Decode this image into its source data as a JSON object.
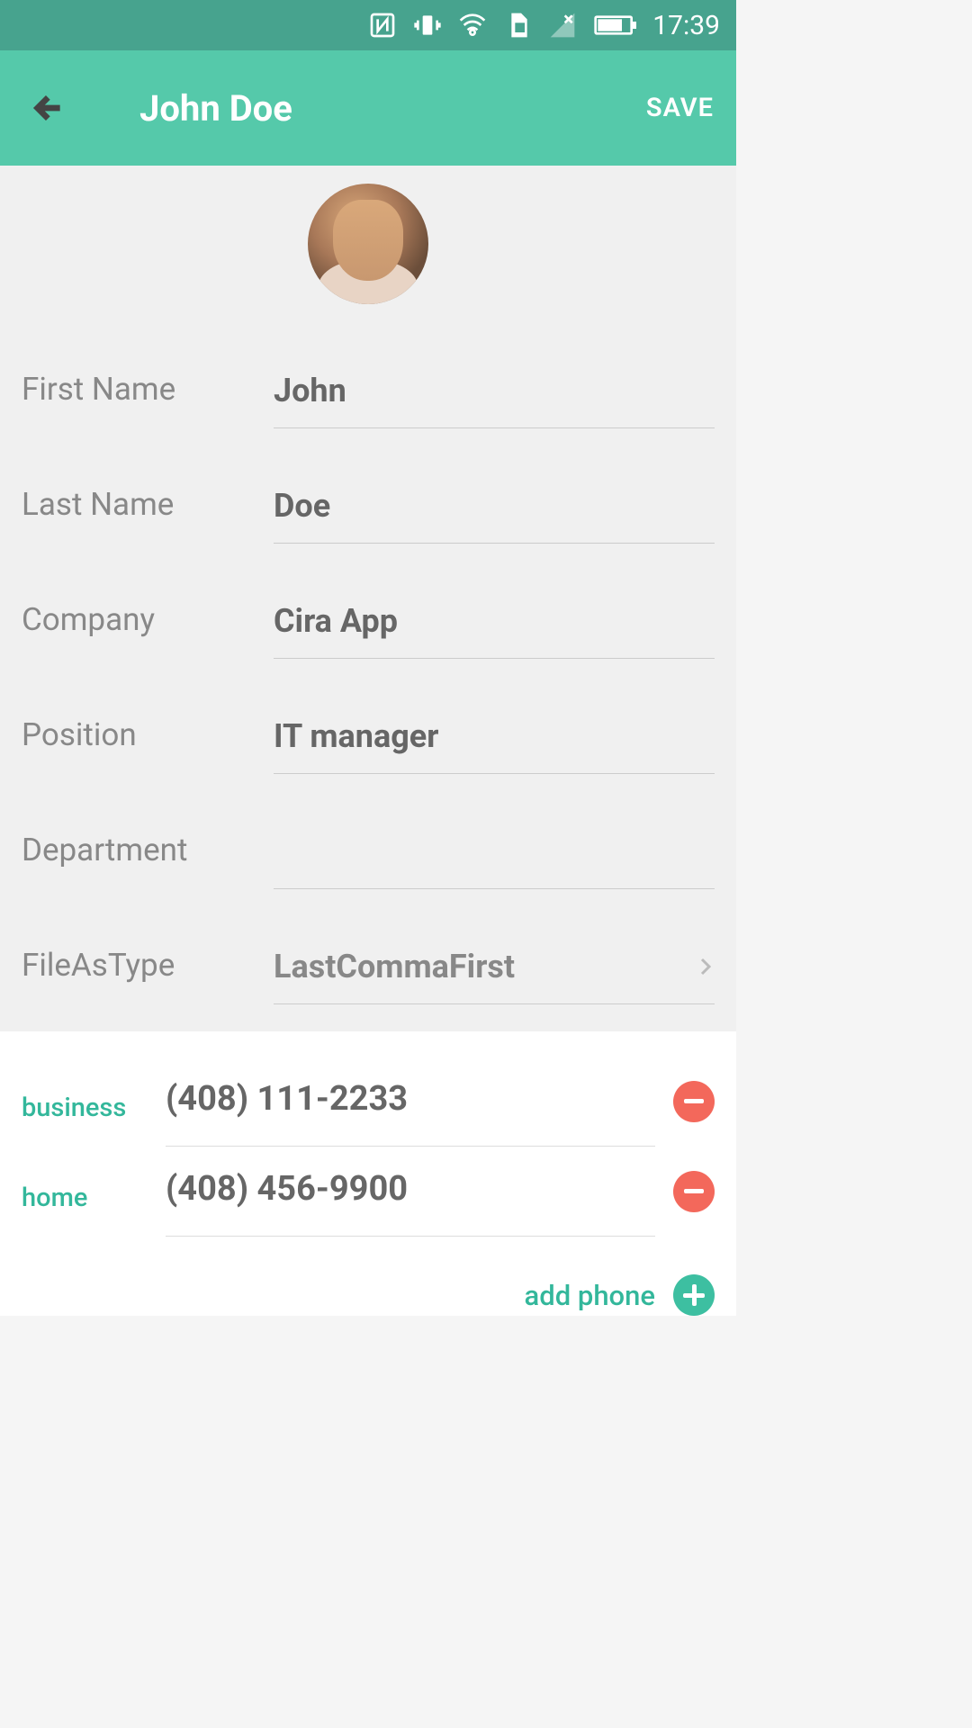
{
  "status": {
    "time": "17:39"
  },
  "header": {
    "title": "John Doe",
    "save": "SAVE"
  },
  "fields": {
    "first_name": {
      "label": "First Name",
      "value": "John"
    },
    "last_name": {
      "label": "Last Name",
      "value": "Doe"
    },
    "company": {
      "label": "Company",
      "value": "Cira App"
    },
    "position": {
      "label": "Position",
      "value": "IT manager"
    },
    "department": {
      "label": "Department",
      "value": ""
    },
    "file_as": {
      "label": "FileAsType",
      "value": "LastCommaFirst"
    }
  },
  "phones": [
    {
      "type": "business",
      "number": "(408) 111-2233"
    },
    {
      "type": "home",
      "number": "(408) 456-9900"
    }
  ],
  "actions": {
    "add_phone": "add phone"
  }
}
